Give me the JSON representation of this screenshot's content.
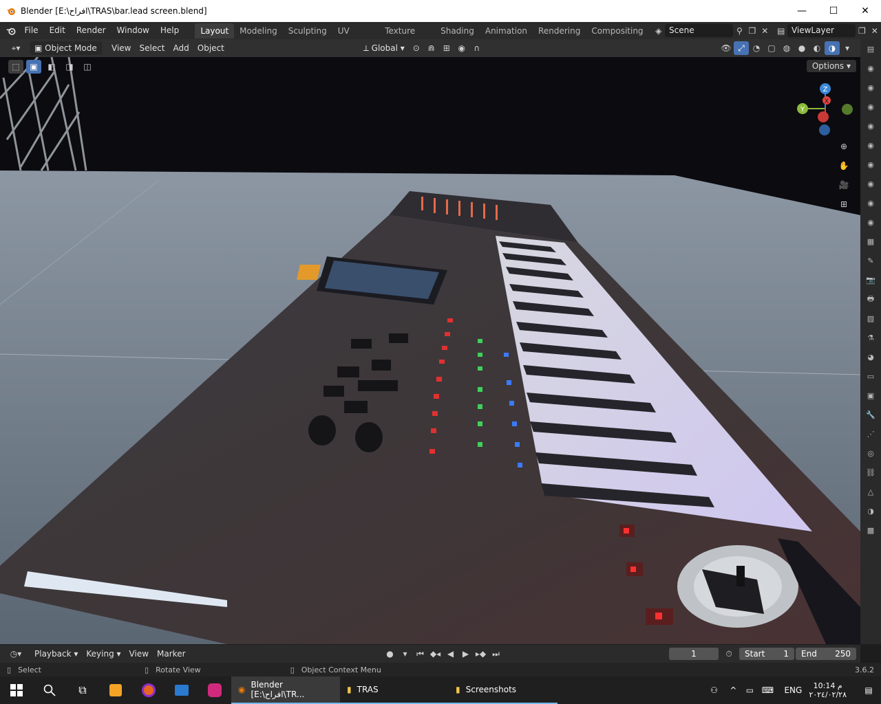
{
  "window": {
    "title": "Blender [E:\\افراح\\TRAS\\bar.lead screen.blend]",
    "controls": {
      "minimize": "—",
      "maximize": "☐",
      "close": "✕"
    }
  },
  "topbar": {
    "menus": [
      "File",
      "Edit",
      "Render",
      "Window",
      "Help"
    ],
    "workspaces": [
      "Layout",
      "Modeling",
      "Sculpting",
      "UV Editing",
      "Texture Paint",
      "Shading",
      "Animation",
      "Rendering",
      "Compositing"
    ],
    "active_workspace": "Layout",
    "scene": "Scene",
    "view_layer": "ViewLayer"
  },
  "viewport_header": {
    "mode": "Object Mode",
    "menus": [
      "View",
      "Select",
      "Add",
      "Object"
    ],
    "orientation": "Global",
    "options_label": "Options"
  },
  "gizmo": {
    "z": "Z",
    "y": "Y",
    "x": "X"
  },
  "timeline": {
    "menus": [
      "Playback",
      "Keying",
      "View",
      "Marker"
    ],
    "current_frame": "1",
    "start_label": "Start",
    "start": "1",
    "end_label": "End",
    "end": "250"
  },
  "statusbar": {
    "hint1": "Select",
    "hint2": "Rotate View",
    "hint3": "Object Context Menu",
    "version": "3.6.2"
  },
  "taskbar": {
    "apps": [
      {
        "label": "Blender [E:\\افراح\\TR...",
        "active": true
      },
      {
        "label": "TRAS",
        "active": false
      },
      {
        "label": "Screenshots",
        "active": false
      }
    ],
    "lang": "ENG",
    "time": "10:14 م",
    "date": "٢٠٢٤/٠٢/٢٨"
  },
  "colors": {
    "accent": "#4772b3",
    "gizmo_x": "#e0433e",
    "gizmo_y": "#8cba3b",
    "gizmo_z": "#3c88d9"
  }
}
